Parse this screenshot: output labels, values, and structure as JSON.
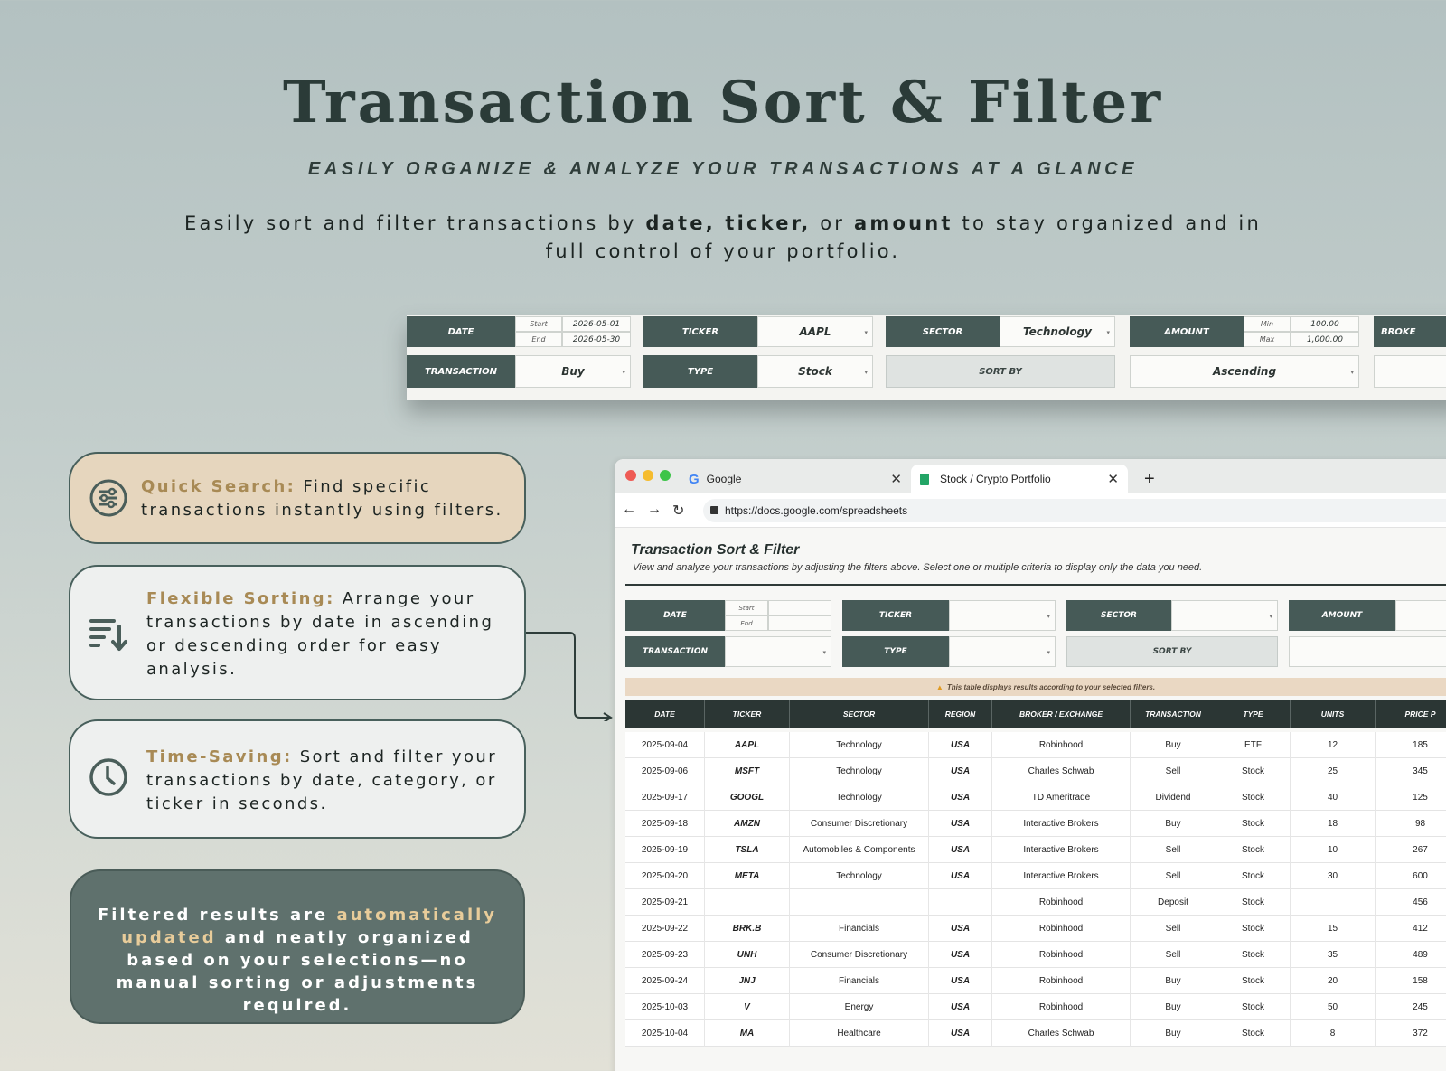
{
  "hero": {
    "title": "Transaction Sort & Filter",
    "subtitle": "EASILY ORGANIZE & ANALYZE YOUR TRANSACTIONS AT A GLANCE",
    "desc_1": "Easily sort and filter transactions by ",
    "desc_b1": "date, ticker,",
    "desc_2": " or ",
    "desc_b2": "amount",
    "desc_3": " to stay organized and in full control of your portfolio."
  },
  "strip": {
    "date_label": "DATE",
    "start_label": "Start",
    "end_label": "End",
    "start_value": "2026-05-01",
    "end_value": "2026-05-30",
    "ticker_label": "TICKER",
    "ticker_value": "AAPL",
    "sector_label": "SECTOR",
    "sector_value": "Technology",
    "amount_label": "AMOUNT",
    "min_label": "Min",
    "max_label": "Max",
    "min_value": "100.00",
    "max_value": "1,000.00",
    "broker_label": "BROKE",
    "transaction_label": "TRANSACTION",
    "transaction_value": "Buy",
    "type_label": "TYPE",
    "type_value": "Stock",
    "sortby_label": "SORT BY",
    "sortby_value": "Ascending"
  },
  "features": {
    "quick_title": "Quick Search:",
    "quick_text": " Find specific transactions instantly using filters.",
    "flex_title": "Flexible Sorting:",
    "flex_text": " Arrange your transactions by date in ascending or descending order for easy analysis.",
    "time_title": "Time-Saving:",
    "time_text": " Sort and filter your transactions by date, category, or ticker in seconds.",
    "dark_1": "Filtered results are ",
    "dark_hl": "automatically updated",
    "dark_2": " and neatly organized based on your selections—no manual sorting or adjustments required."
  },
  "browser": {
    "tab1": "Google",
    "tab2": "Stock / Crypto Portfolio",
    "url": "https://docs.google.com/spreadsheets"
  },
  "sheet": {
    "title": "Transaction Sort & Filter",
    "subtitle": "View and analyze your transactions by adjusting the filters above. Select one or multiple criteria to display only the data you need.",
    "date_label": "DATE",
    "start_label": "Start",
    "end_label": "End",
    "ticker_label": "TICKER",
    "sector_label": "SECTOR",
    "amount_label": "AMOUNT",
    "transaction_label": "TRANSACTION",
    "type_label": "TYPE",
    "sortby_label": "SORT BY",
    "notice": "This table displays results according to your selected filters.",
    "columns": [
      "DATE",
      "TICKER",
      "SECTOR",
      "REGION",
      "BROKER / EXCHANGE",
      "TRANSACTION",
      "TYPE",
      "UNITS",
      "PRICE P"
    ],
    "rows": [
      [
        "2025-09-04",
        "AAPL",
        "Technology",
        "USA",
        "Robinhood",
        "Buy",
        "ETF",
        "12",
        "185"
      ],
      [
        "2025-09-06",
        "MSFT",
        "Technology",
        "USA",
        "Charles Schwab",
        "Sell",
        "Stock",
        "25",
        "345"
      ],
      [
        "2025-09-17",
        "GOOGL",
        "Technology",
        "USA",
        "TD Ameritrade",
        "Dividend",
        "Stock",
        "40",
        "125"
      ],
      [
        "2025-09-18",
        "AMZN",
        "Consumer Discretionary",
        "USA",
        "Interactive Brokers",
        "Buy",
        "Stock",
        "18",
        "98"
      ],
      [
        "2025-09-19",
        "TSLA",
        "Automobiles & Components",
        "USA",
        "Interactive Brokers",
        "Sell",
        "Stock",
        "10",
        "267"
      ],
      [
        "2025-09-20",
        "META",
        "Technology",
        "USA",
        "Interactive Brokers",
        "Sell",
        "Stock",
        "30",
        "600"
      ],
      [
        "2025-09-21",
        "",
        "",
        "",
        "Robinhood",
        "Deposit",
        "Stock",
        "",
        "456"
      ],
      [
        "2025-09-22",
        "BRK.B",
        "Financials",
        "USA",
        "Robinhood",
        "Sell",
        "Stock",
        "15",
        "412"
      ],
      [
        "2025-09-23",
        "UNH",
        "Consumer Discretionary",
        "USA",
        "Robinhood",
        "Sell",
        "Stock",
        "35",
        "489"
      ],
      [
        "2025-09-24",
        "JNJ",
        "Financials",
        "USA",
        "Robinhood",
        "Buy",
        "Stock",
        "20",
        "158"
      ],
      [
        "2025-10-03",
        "V",
        "Energy",
        "USA",
        "Robinhood",
        "Buy",
        "Stock",
        "50",
        "245"
      ],
      [
        "2025-10-04",
        "MA",
        "Healthcare",
        "USA",
        "Charles Schwab",
        "Buy",
        "Stock",
        "8",
        "372"
      ]
    ]
  },
  "colors": {
    "accent": "#465a57",
    "gold": "#a88a55",
    "dark_card": "#5f716d",
    "beige_card": "#e6d6be"
  }
}
